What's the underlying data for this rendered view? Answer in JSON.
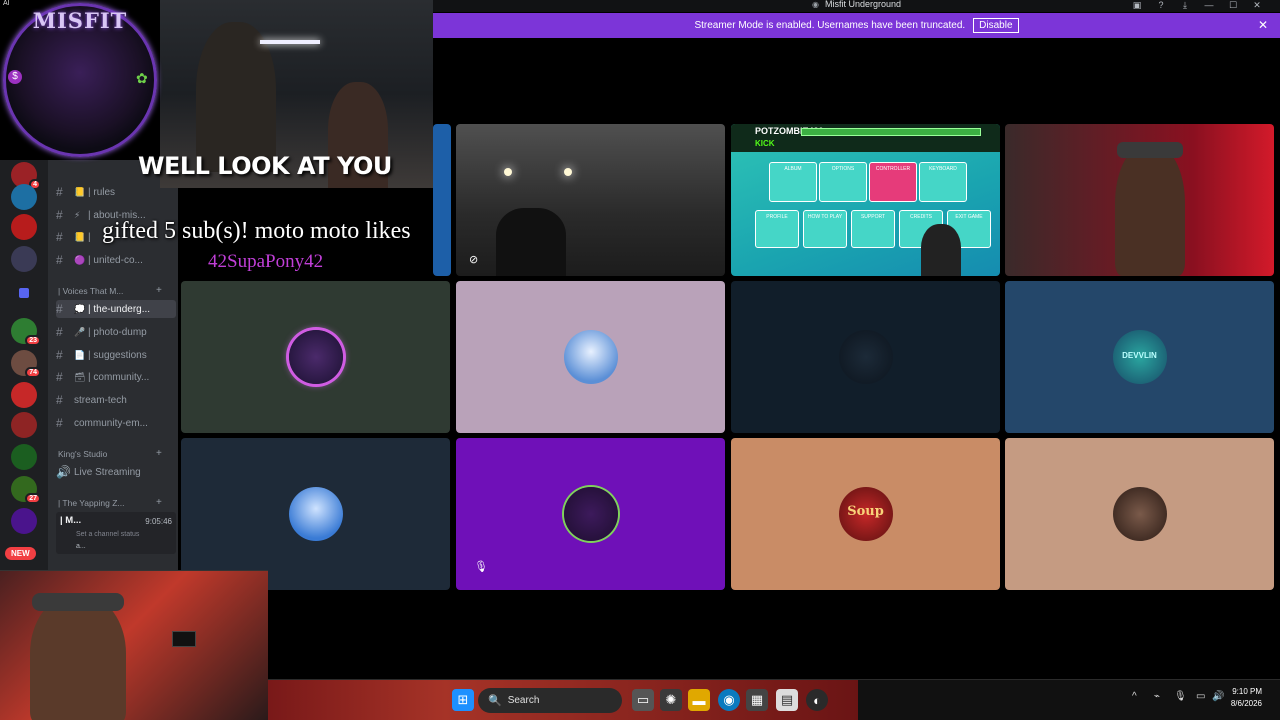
{
  "window": {
    "title": "Misfit Underground"
  },
  "banner": {
    "message": "Streamer Mode is enabled. Usernames have been truncated.",
    "disable_label": "Disable",
    "close_icon": "✕"
  },
  "overlay": {
    "logo_text": "MISFIT",
    "logo_dollar": "$",
    "corner_text": "AI",
    "clip_caption": "WELL LOOK AT YOU",
    "alert_text": "gifted 5 sub(s)! moto moto likes",
    "alert_user": "42SupaPony42"
  },
  "guild_badges": [
    "4",
    "23",
    "74",
    "27"
  ],
  "new_label": "NEW",
  "channels": [
    {
      "name": "| rules",
      "emoji": "📒"
    },
    {
      "name": "| about-mis...",
      "emoji": "⚡"
    },
    {
      "name": "|",
      "emoji": "📒"
    },
    {
      "name": "| united-co...",
      "emoji": "🟣"
    },
    {
      "name": "| the-underg...",
      "emoji": "💭"
    },
    {
      "name": "| photo-dump",
      "emoji": "🎤"
    },
    {
      "name": "| suggestions",
      "emoji": "📄"
    },
    {
      "name": "| community...",
      "emoji": "🗃"
    },
    {
      "name": "stream-tech",
      "emoji": ""
    },
    {
      "name": "community-em...",
      "emoji": ""
    }
  ],
  "categories": {
    "voices": "| Voices That M...",
    "kings": "King's Studio",
    "yapping": "| The Yapping Z..."
  },
  "live_streaming": "Live Streaming",
  "voice_status": {
    "name": "| M...",
    "timer": "9:05:46",
    "status": "Set a channel status",
    "user": "a..."
  },
  "tiles": {
    "gaming_title": "POTZOMBIE420",
    "gaming_sub": "KICK",
    "menu": [
      "ALBUM",
      "OPTIONS",
      "CONTROLLER",
      "KEYBOARD",
      "PROFILE",
      "HOW TO PLAY",
      "SUPPORT",
      "CREDITS",
      "EXIT GAME"
    ],
    "devvlin": "DEVVLIN",
    "soup": "Soup"
  },
  "taskbar": {
    "search_label": "Search",
    "time": "9:10 PM",
    "date": "8/6/2026"
  },
  "colors": {
    "banner": "#7c35d8",
    "tile_dark_green": "#2f3a32",
    "tile_lavender": "#b9a2b9",
    "tile_navy": "#111e2a",
    "tile_steel": "#24476a",
    "tile_purple": "#6f10b8",
    "tile_salmon": "#c98c66",
    "tile_tan": "#c59b82"
  }
}
